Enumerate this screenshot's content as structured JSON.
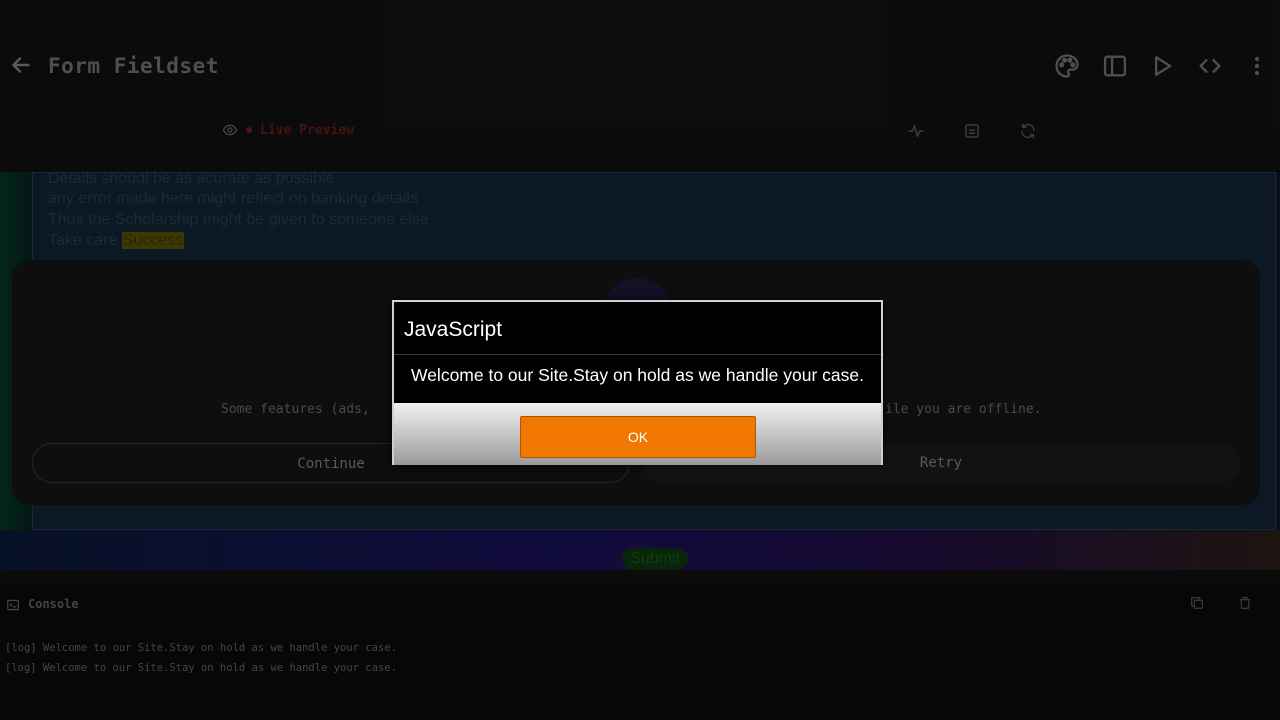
{
  "topbar": {
    "title": "Form Fieldset"
  },
  "preview": {
    "live_label": "Live Preview",
    "lines": [
      "Details shoudl be as acurate as possible",
      "any error made here might reflect on banking details",
      "Thus the Scholarship might be given to someone else"
    ],
    "take_care": "Take care ",
    "success": "Success",
    "submit_label": "Submit"
  },
  "offline": {
    "message_left": "Some features (ads,",
    "message_right": "ile you are offline.",
    "continue_label": "Continue",
    "retry_label": "Retry"
  },
  "dialog": {
    "title": "JavaScript",
    "message": "Welcome to our Site.Stay on hold as we handle your case.",
    "ok_label": "OK"
  },
  "console": {
    "title": "Console",
    "logs": [
      "[log] Welcome to our Site.Stay on hold as we handle your case.",
      "[log] Welcome to our Site.Stay on hold as we handle your case."
    ]
  },
  "colors": {
    "ok_button": "#f07800",
    "live_dot": "#7a1f1f"
  },
  "icons": [
    "back-arrow-icon",
    "palette-icon",
    "sidebar-icon",
    "play-icon",
    "code-icon",
    "more-vertical-icon",
    "eye-icon",
    "activity-icon",
    "image-icon",
    "refresh-icon",
    "terminal-icon",
    "copy-icon",
    "trash-icon"
  ]
}
